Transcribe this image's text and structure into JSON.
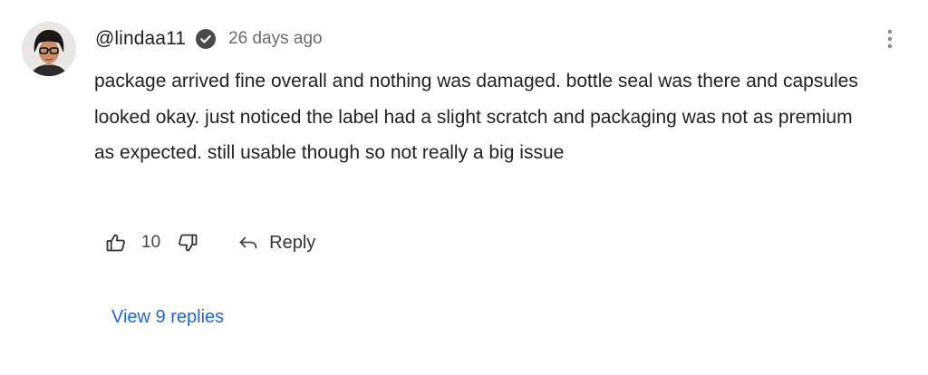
{
  "comment": {
    "username": "@lindaa11",
    "verified": true,
    "timestamp": "26 days ago",
    "text": "package arrived fine overall and nothing was damaged. bottle seal was there and capsules looked okay. just noticed the label had a slight scratch and packaging was not as premium as expected. still usable though so not really a big issue",
    "likes": "10",
    "reply_label": "Reply",
    "view_replies_label": "View 9 replies"
  },
  "icons": {
    "avatar": "user-avatar",
    "verified": "verified-check-icon",
    "menu": "more-vertical-icon",
    "like": "thumbs-up-icon",
    "dislike": "thumbs-down-icon",
    "reply": "reply-arrow-icon"
  },
  "colors": {
    "link": "#2266d6",
    "verified_badge": "#4a4a4a",
    "timestamp": "#6b6b6b"
  }
}
